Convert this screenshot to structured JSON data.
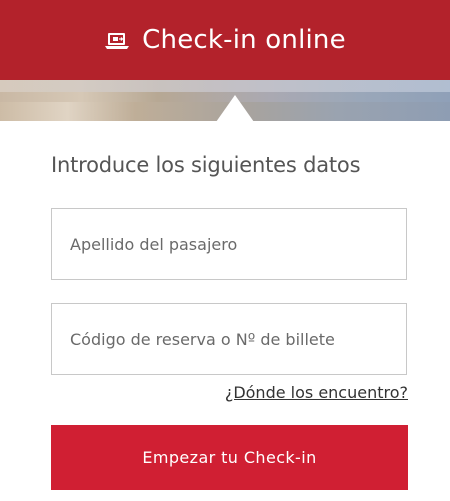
{
  "header": {
    "title": "Check-in online",
    "icon": "laptop-checkin-icon",
    "background_color": "#b3222b"
  },
  "form": {
    "heading": "Introduce los siguientes datos",
    "surname_placeholder": "Apellido del pasajero",
    "surname_value": "",
    "booking_placeholder": "Código de reserva o Nº de billete",
    "booking_value": "",
    "help_link": "¿Dónde los encuentro?",
    "submit_label": "Empezar tu Check-in",
    "submit_color": "#d01f33"
  }
}
